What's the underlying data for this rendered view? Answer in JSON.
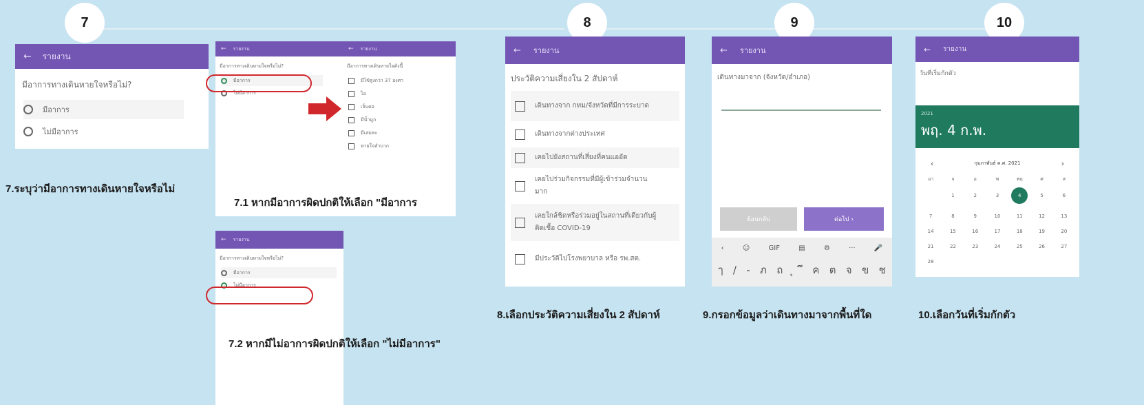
{
  "steps": [
    "7",
    "8",
    "9",
    "10"
  ],
  "app_title": "รายงาน",
  "back_arrow": "←",
  "step7": {
    "question": "มีอาการทางเดินหายใจหรือไม่?",
    "options": [
      "มีอาการ",
      "ไม่มีอาการ"
    ],
    "caption": "7.ระบุว่ามีอาการทางเดินหายใจหรือไม่"
  },
  "step71": {
    "question": "มีอาการทางเดินหายใจหรือไม่?",
    "options": [
      "มีอาการ",
      "ไม่มีอาการ"
    ],
    "caption": "7.1 หากมีอาการผิดปกติให้เลือก \"มีอาการ"
  },
  "symptoms": {
    "question": "มีอาการทางเดินหายใจดังนี้",
    "options": [
      "มีไข้สูงกว่า 37 องศา",
      "ไอ",
      "เจ็บคอ",
      "มีน้ำมูก",
      "มีเสมหะ",
      "หายใจลำบาก"
    ]
  },
  "step72": {
    "question": "มีอาการทางเดินหายใจหรือไม่?",
    "options": [
      "มีอาการ",
      "ไม่มีอาการ"
    ],
    "caption": "7.2 หากมีไม่อาการผิดปกติให้เลือก \"ไม่มีอาการ\""
  },
  "step8": {
    "heading": "ประวัติความเสี่ยงใน 2 สัปดาห์",
    "items": [
      "เดินทางจาก กทม/จังหวัดที่มีการระบาด",
      "เดินทางจากต่างประเทศ",
      "เคยไปยังสถานที่เสี่ยงที่คนแออัด",
      "เคยไปร่วมกิจกรรมที่มีผู้เข้าร่วมจำนวนมาก",
      "เคยใกล้ชิดหรือร่วมอยู่ในสถานที่เดียวกับผู้ติดเชื้อ COVID-19",
      "มีประวัติไปโรงพยาบาล หรือ รพ.สต."
    ],
    "caption": "8.เลือกประวัติความเสี่ยงใน 2 สัปดาห์"
  },
  "step9": {
    "label": "เดินทางมาจาก (จังหวัด/อำเภอ)",
    "input_value": "",
    "back_button": "ย้อนกลับ",
    "next_button": "ต่อไป ›",
    "kb_row1": [
      "‹",
      "☺",
      "GIF",
      "▤",
      "⚙",
      "···",
      "🎤"
    ],
    "kb_row2": [
      "ๅ",
      "/",
      "-",
      "ภ",
      "ถ",
      "ุ",
      "ึ",
      "ค",
      "ต",
      "จ",
      "ข",
      "ช"
    ],
    "caption": "9.กรอกข้อมูลว่าเดินทางมาจากพื้นที่ใด"
  },
  "step10": {
    "label": "วันที่เริ่มกักตัว",
    "year": "2021",
    "date_display": "พฤ. 4 ก.พ.",
    "month_label": "กุมภาพันธ์ ค.ศ. 2021",
    "prev": "‹",
    "next": "›",
    "weekdays": [
      "อา",
      "จ",
      "อ",
      "พ",
      "พฤ",
      "ศ",
      "ส"
    ],
    "selected_day": "4",
    "days": [
      "",
      "1",
      "2",
      "3",
      "4",
      "5",
      "6",
      "7",
      "8",
      "9",
      "10",
      "11",
      "12",
      "13",
      "14",
      "15",
      "16",
      "17",
      "18",
      "19",
      "20",
      "21",
      "22",
      "23",
      "24",
      "25",
      "26",
      "27",
      "28"
    ],
    "caption": "10.เลือกวันที่เริ่มกักตัว"
  },
  "colors": {
    "background": "#c6e3f1",
    "appbar": "#7355b4",
    "radio_selected": "#2e8b57",
    "calendar_header": "#1f7a5e",
    "highlight_box": "#d0272c",
    "arrow": "#d0272c"
  }
}
